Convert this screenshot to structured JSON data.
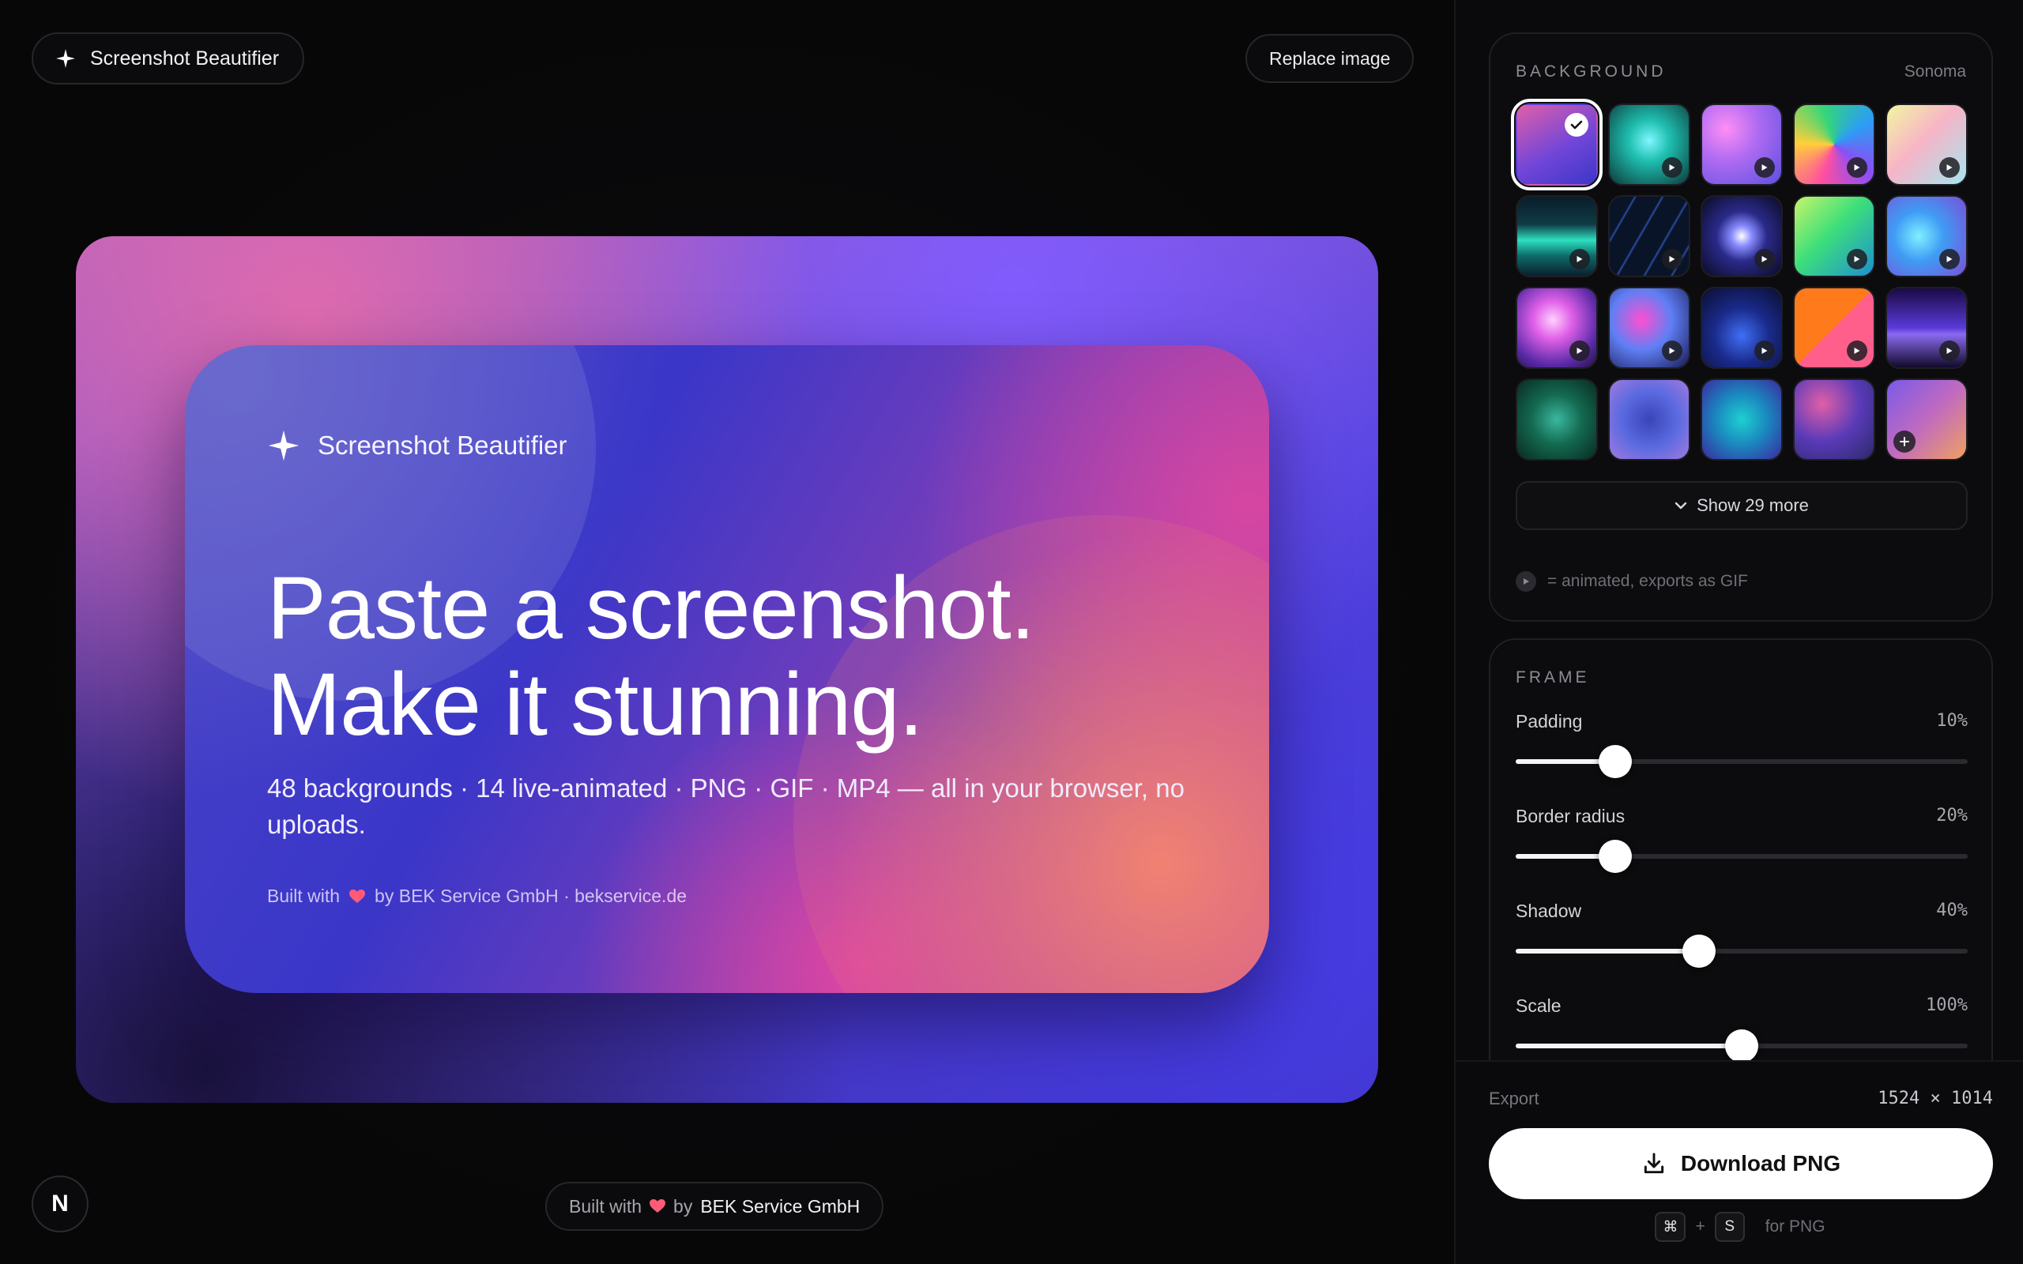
{
  "app": {
    "title": "Screenshot Beautifier"
  },
  "header": {
    "replace_label": "Replace image"
  },
  "preview": {
    "brand": "Screenshot Beautifier",
    "headline_line1": "Paste a screenshot.",
    "headline_line2": "Make it stunning.",
    "subtitle": "48 backgrounds · 14 live-animated · PNG · GIF · MP4 — all in your browser, no uploads.",
    "credit_prefix": "Built with",
    "credit_suffix": "by BEK Service GmbH · bekservice.de"
  },
  "footer": {
    "badge": "N",
    "prefix": "Built with",
    "by": "by",
    "company": "BEK Service GmbH"
  },
  "background": {
    "title": "BACKGROUND",
    "selected_name": "Sonoma",
    "show_more_label": "Show 29 more",
    "animated_note": "= animated, exports as GIF",
    "swatches": [
      {
        "name": "swatch-sonoma",
        "gradient": "linear-gradient(150deg,#e05fa8 0%,#7246d8 55%,#3b36c8 100%)",
        "animated": false,
        "selected": true
      },
      {
        "name": "swatch-aurora",
        "gradient": "radial-gradient(circle at 50% 45%,#7ff7ff 0%,#1fbfb0 35%,#0c3a3a 100%)",
        "animated": true
      },
      {
        "name": "swatch-lilac",
        "gradient": "radial-gradient(circle at 30% 30%,#ff8ef5 0%,#b16cf2 40%,#5c4fe0 100%)",
        "animated": true
      },
      {
        "name": "swatch-prism",
        "gradient": "conic-gradient(from 200deg,#ff4fa0,#ffcf3a,#32d67a,#2c9df5,#8a4ff5,#ff4fa0)",
        "animated": true
      },
      {
        "name": "swatch-pastel",
        "gradient": "linear-gradient(135deg,#f2f6a0 0%,#f7b4c7 45%,#a5e6f0 100%)",
        "animated": true
      },
      {
        "name": "swatch-waves",
        "gradient": "linear-gradient(180deg,#0a1c2a 0%,#0f3b45 35%,#2de0c0 55%,#0d6a68 75%,#0a2030 100%)",
        "animated": true
      },
      {
        "name": "swatch-lines",
        "gradient": "repeating-linear-gradient(120deg,#0a1428 0px,#0a1428 26px,#2a4fa8 28px,#0a1428 30px)",
        "animated": true
      },
      {
        "name": "swatch-orb",
        "gradient": "radial-gradient(circle at 50% 50%,#ffffff 0%,#8a8cff 18%,#2a2a8a 45%,#0a0a22 100%)",
        "animated": true
      },
      {
        "name": "swatch-lime",
        "gradient": "linear-gradient(135deg,#c7f56a 0%,#3ddf7a 45%,#1e8fd0 100%)",
        "animated": true
      },
      {
        "name": "swatch-glacier",
        "gradient": "radial-gradient(circle at 40% 50%,#7ff0ff 0%,#3f9cf5 40%,#7a4fd8 100%)",
        "animated": true
      },
      {
        "name": "swatch-bloom",
        "gradient": "radial-gradient(circle at 45% 40%,#ffd0ff 0%,#e060e8 30%,#5a2aa8 70%,#241042 100%)",
        "animated": true
      },
      {
        "name": "swatch-neon",
        "gradient": "radial-gradient(circle at 40% 40%,#ff4fd0 0%,#5f7ff5 45%,#1a1a55 100%)",
        "animated": true
      },
      {
        "name": "swatch-midnight",
        "gradient": "radial-gradient(circle at 50% 60%,#3f6ff5 0%,#1a2a8a 45%,#0a0e30 100%)",
        "animated": true
      },
      {
        "name": "swatch-sunset",
        "gradient": "linear-gradient(135deg,#ff7a1a 0%,#ff7a1a 50%,#ff5f8a 50%,#ff5f8a 100%)",
        "animated": true
      },
      {
        "name": "swatch-horizon",
        "gradient": "linear-gradient(180deg,#1a0a44 0%,#5a3ad8 50%,#8a6af0 58%,#120a2a 100%)",
        "animated": true
      },
      {
        "name": "swatch-forest",
        "gradient": "radial-gradient(circle at 50% 50%,#3ab8a0 0%,#136a50 45%,#0a2a22 100%)",
        "animated": false
      },
      {
        "name": "swatch-periwinkle",
        "gradient": "radial-gradient(circle at 50% 50%,#3a44b8 0%,#5a6ae0 50%,#a07ae0 100%)",
        "animated": false
      },
      {
        "name": "swatch-lagoon",
        "gradient": "radial-gradient(circle at 50% 50%,#1fd0d0 0%,#1a8ac0 45%,#3a2aa0 100%)",
        "animated": false
      },
      {
        "name": "swatch-dusk",
        "gradient": "radial-gradient(circle at 35% 30%,#e05fa8 0%,#5a3ab8 50%,#2a2a6a 100%)",
        "animated": false
      },
      {
        "name": "swatch-custom",
        "gradient": "linear-gradient(135deg,#7a5ae8 0%,#c06ac0 50%,#f0a060 100%)",
        "animated": false,
        "custom": true
      }
    ]
  },
  "frame": {
    "title": "FRAME",
    "sliders": [
      {
        "label": "Padding",
        "value": "10%",
        "position": 0.22
      },
      {
        "label": "Border radius",
        "value": "20%",
        "position": 0.22
      },
      {
        "label": "Shadow",
        "value": "40%",
        "position": 0.405
      },
      {
        "label": "Scale",
        "value": "100%",
        "position": 0.5
      }
    ]
  },
  "export": {
    "label": "Export",
    "dimensions": "1524 × 1014",
    "download_label": "Download PNG",
    "shortcut_key1": "⌘",
    "shortcut_plus": "+",
    "shortcut_key2": "S",
    "shortcut_suffix": "for PNG"
  },
  "colors": {
    "accent": "#ffffff",
    "heart": "#ff5a78",
    "panel_bg": "#0a0a0c"
  }
}
